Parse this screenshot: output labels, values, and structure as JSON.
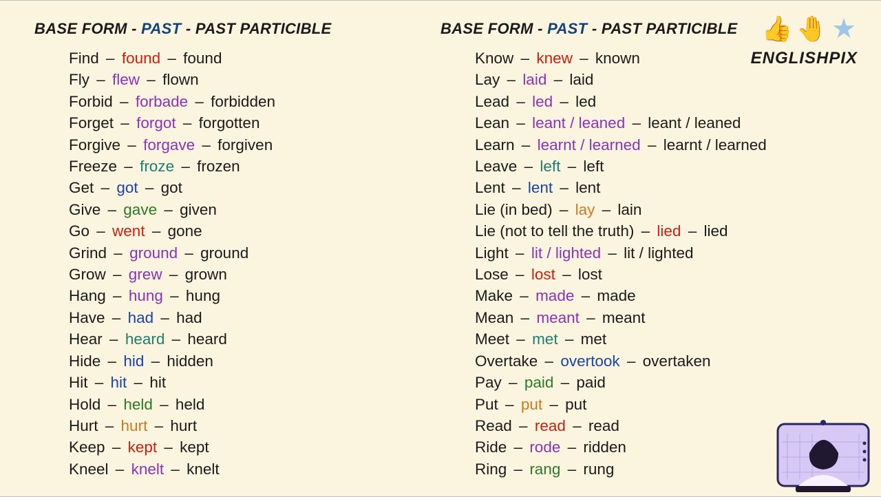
{
  "header": {
    "base": "BASE FORM",
    "past": "PAST",
    "pp": "PAST PARTICIBLE"
  },
  "brand": {
    "name": "ENGLISHPIX",
    "thumb": "👍",
    "hand": "🤚",
    "star": "★"
  },
  "colors": {
    "red": "c-red",
    "blue": "c-blue",
    "purple": "c-purple",
    "teal": "c-teal",
    "green": "c-green",
    "orange": "c-orange"
  },
  "col1": [
    {
      "b": "Find",
      "p": "found",
      "pc": "red",
      "pp": "found"
    },
    {
      "b": "Fly",
      "p": "flew",
      "pc": "purple",
      "pp": "flown"
    },
    {
      "b": "Forbid",
      "p": "forbade",
      "pc": "purple",
      "pp": "forbidden"
    },
    {
      "b": "Forget",
      "p": "forgot",
      "pc": "purple",
      "pp": "forgotten"
    },
    {
      "b": "Forgive",
      "p": "forgave",
      "pc": "purple",
      "pp": "forgiven"
    },
    {
      "b": "Freeze",
      "p": "froze",
      "pc": "teal",
      "pp": "frozen"
    },
    {
      "b": "Get",
      "p": "got",
      "pc": "blue",
      "pp": "got"
    },
    {
      "b": "Give",
      "p": "gave",
      "pc": "green",
      "pp": "given"
    },
    {
      "b": "Go",
      "p": "went",
      "pc": "red",
      "pp": "gone"
    },
    {
      "b": "Grind",
      "p": "ground",
      "pc": "purple",
      "pp": "ground"
    },
    {
      "b": "Grow",
      "p": "grew",
      "pc": "purple",
      "pp": "grown"
    },
    {
      "b": "Hang",
      "p": "hung",
      "pc": "purple",
      "pp": "hung"
    },
    {
      "b": "Have",
      "p": "had",
      "pc": "blue",
      "pp": "had"
    },
    {
      "b": "Hear",
      "p": "heard",
      "pc": "teal",
      "pp": "heard"
    },
    {
      "b": "Hide",
      "p": "hid",
      "pc": "blue",
      "pp": "hidden"
    },
    {
      "b": "Hit",
      "p": "hit",
      "pc": "blue",
      "pp": "hit"
    },
    {
      "b": "Hold",
      "p": "held",
      "pc": "green",
      "pp": "held"
    },
    {
      "b": "Hurt",
      "p": "hurt",
      "pc": "orange",
      "pp": "hurt"
    },
    {
      "b": "Keep",
      "p": "kept",
      "pc": "red",
      "pp": "kept"
    },
    {
      "b": "Kneel",
      "p": "knelt",
      "pc": "purple",
      "pp": "knelt"
    }
  ],
  "col2": [
    {
      "b": "Know",
      "p": "knew",
      "pc": "red",
      "pp": "known"
    },
    {
      "b": "Lay",
      "p": "laid",
      "pc": "purple",
      "pp": "laid"
    },
    {
      "b": "Lead",
      "p": "led",
      "pc": "purple",
      "pp": "led"
    },
    {
      "b": "Lean",
      "p": "leant / leaned",
      "pc": "purple",
      "pp": "leant / leaned"
    },
    {
      "b": "Learn",
      "p": "learnt / learned",
      "pc": "purple",
      "pp": "learnt / learned"
    },
    {
      "b": "Leave",
      "p": "left",
      "pc": "teal",
      "pp": "left"
    },
    {
      "b": "Lent",
      "p": "lent",
      "pc": "blue",
      "pp": "lent"
    },
    {
      "b": "Lie (in bed)",
      "p": "lay",
      "pc": "orange",
      "pp": "lain"
    },
    {
      "b": "Lie (not to tell the truth)",
      "p": "lied",
      "pc": "red",
      "pp": "lied"
    },
    {
      "b": "Light",
      "p": "lit / lighted",
      "pc": "purple",
      "pp": "lit / lighted"
    },
    {
      "b": "Lose",
      "p": "lost",
      "pc": "red",
      "pp": "lost"
    },
    {
      "b": "Make",
      "p": "made",
      "pc": "purple",
      "pp": "made"
    },
    {
      "b": "Mean",
      "p": "meant",
      "pc": "purple",
      "pp": "meant"
    },
    {
      "b": "Meet",
      "p": "met",
      "pc": "teal",
      "pp": "met"
    },
    {
      "b": "Overtake",
      "p": "overtook",
      "pc": "blue",
      "pp": "overtaken"
    },
    {
      "b": "Pay",
      "p": "paid",
      "pc": "green",
      "pp": "paid"
    },
    {
      "b": "Put",
      "p": "put",
      "pc": "orange",
      "pp": "put"
    },
    {
      "b": "Read",
      "p": "read",
      "pc": "red",
      "pp": "read"
    },
    {
      "b": "Ride",
      "p": "rode",
      "pc": "purple",
      "pp": "ridden"
    },
    {
      "b": "Ring",
      "p": "rang",
      "pc": "green",
      "pp": "rung"
    }
  ]
}
